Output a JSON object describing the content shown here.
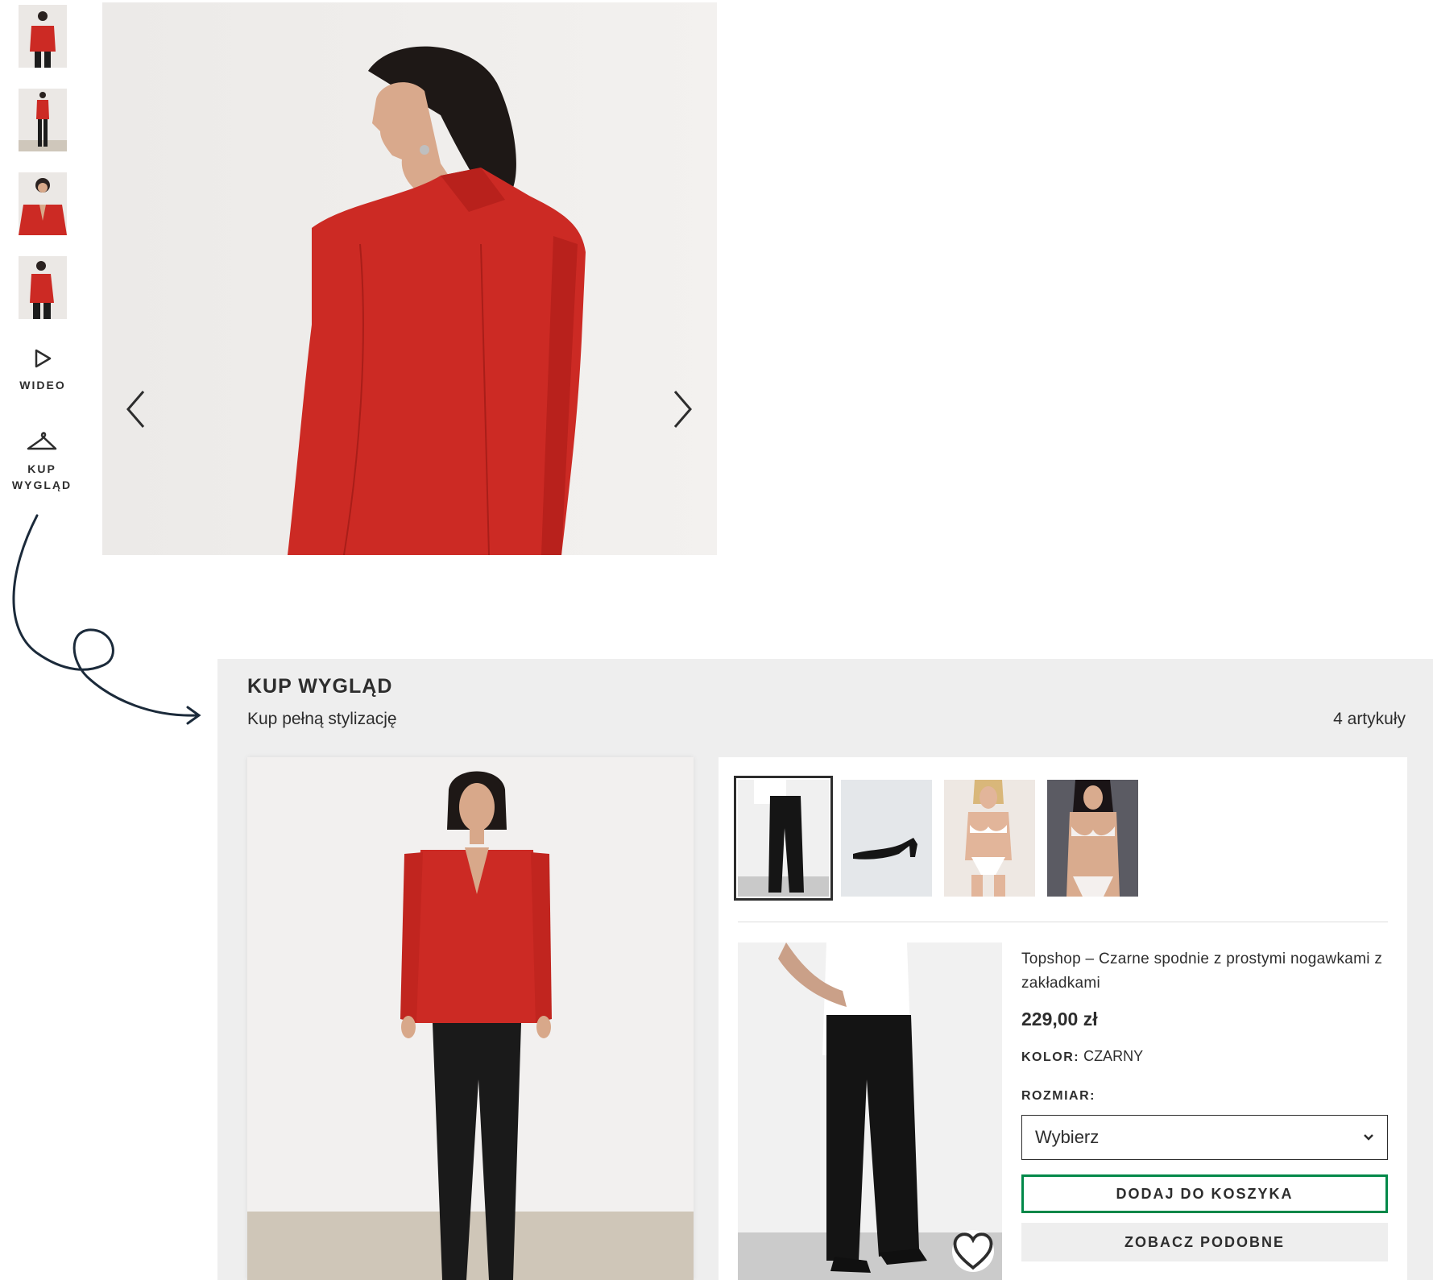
{
  "colors": {
    "accent_green": "#018849",
    "text": "#2d2d2d",
    "panel_bg": "#eeeeee",
    "jacket_red": "#cc2a24"
  },
  "gallery": {
    "thumbnails": [
      "thumb-1",
      "thumb-2",
      "thumb-3",
      "thumb-4"
    ],
    "video_label": "WIDEO",
    "shop_look_label": "KUP WYGLĄD",
    "icons": {
      "video": "play-icon",
      "shop_look": "hanger-icon",
      "prev": "chevron-left-icon",
      "next": "chevron-right-icon"
    }
  },
  "shop_the_look": {
    "title": "KUP WYGLĄD",
    "subtitle": "Kup pełną stylizację",
    "count": "4 artykuły",
    "product": {
      "name": "Topshop – Czarne spodnie z prostymi nogawkami z zakładkami",
      "price": "229,00 zł",
      "color_label": "KOLOR:",
      "color_value": "CZARNY",
      "size_label": "ROZMIAR:",
      "size_value": "Wybierz",
      "add_to_bag": "DODAJ DO KOSZYKA",
      "see_similar": "ZOBACZ PODOBNE"
    }
  }
}
